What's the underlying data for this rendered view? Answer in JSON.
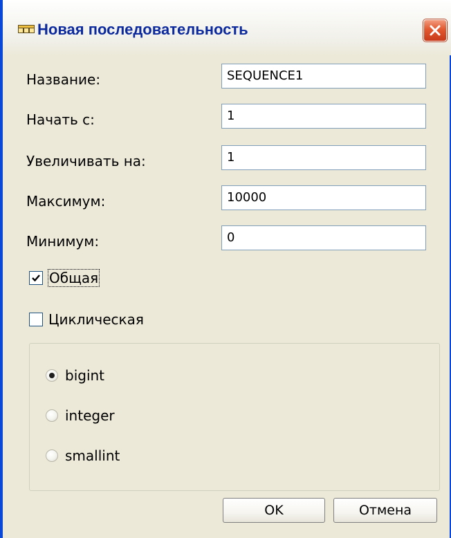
{
  "window": {
    "title": "Новая последовательность",
    "title_color": "#0c2a9e",
    "title_icon": "table-grid-icon",
    "close_icon": "close-icon"
  },
  "form": {
    "name_label": "Название:",
    "name_value": "SEQUENCE1",
    "start_label": "Начать с:",
    "start_value": "1",
    "increment_label": "Увеличивать на:",
    "increment_value": "1",
    "max_label": "Максимум:",
    "max_value": "10000",
    "min_label": "Минимум:",
    "min_value": "0"
  },
  "options": {
    "shared_label": "Общая",
    "shared_checked": true,
    "cyclic_label": "Циклическая",
    "cyclic_checked": false
  },
  "types": {
    "selected": "bigint",
    "items": [
      {
        "label": "bigint",
        "selected": true
      },
      {
        "label": "integer",
        "selected": false
      },
      {
        "label": "smallint",
        "selected": false
      }
    ]
  },
  "buttons": {
    "ok_label": "OK",
    "cancel_label": "Отмена"
  }
}
